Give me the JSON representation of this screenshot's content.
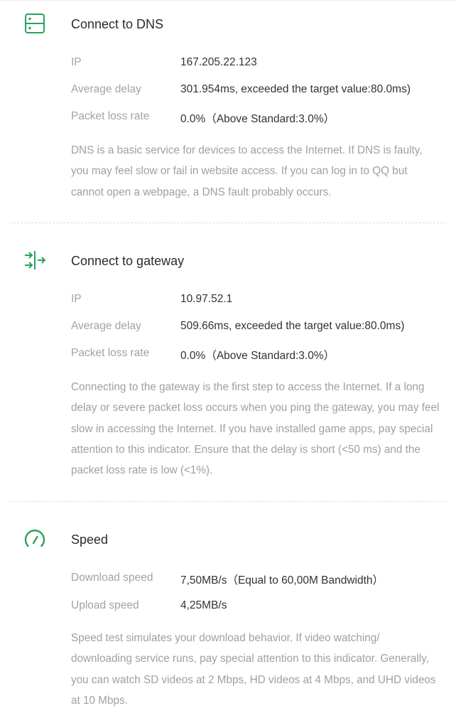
{
  "accent_color": "#27a35a",
  "sections": [
    {
      "icon": "server-icon",
      "title": "Connect to DNS",
      "rows": [
        {
          "label": "IP",
          "value": "167.205.22.123"
        },
        {
          "label": "Average delay",
          "value": "301.954ms, exceeded the target value:80.0ms)"
        },
        {
          "label": "Packet loss rate",
          "value": "0.0%（Above Standard:3.0%）"
        }
      ],
      "description": "DNS is a basic service for devices to access the Internet. If DNS is faulty, you may feel slow or fail in website access. If you can log in to QQ but cannot open a webpage, a DNS fault probably occurs."
    },
    {
      "icon": "gateway-arrows-icon",
      "title": "Connect to gateway",
      "rows": [
        {
          "label": "IP",
          "value": "10.97.52.1"
        },
        {
          "label": "Average delay",
          "value": "509.66ms, exceeded the target value:80.0ms)"
        },
        {
          "label": "Packet loss rate",
          "value": "0.0%（Above Standard:3.0%）"
        }
      ],
      "description": "Connecting to the gateway is the first step to access the Internet. If a long delay or severe packet loss occurs when you ping the gateway, you may feel slow in accessing the Internet. If you have installed game apps, pay special attention to this indicator. Ensure that the delay is short (<50 ms) and the packet loss rate is low (<1%)."
    },
    {
      "icon": "speedometer-icon",
      "title": "Speed",
      "rows": [
        {
          "label": "Download speed",
          "value": "7,50MB/s（Equal to 60,00M Bandwidth）"
        },
        {
          "label": "Upload speed",
          "value": "4,25MB/s"
        }
      ],
      "description": "Speed test simulates your download behavior. If video watching/ downloading service runs, pay special attention to this indicator. Generally, you can watch SD videos at 2 Mbps, HD videos at 4 Mbps, and UHD videos at 10 Mbps."
    }
  ]
}
